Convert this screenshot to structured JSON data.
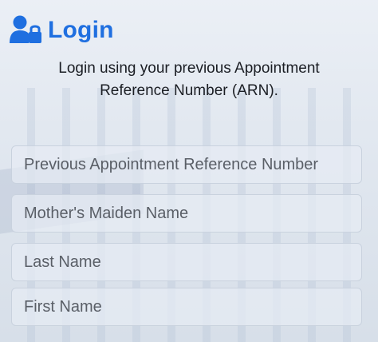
{
  "header": {
    "icon": "user-lock-icon",
    "title": "Login"
  },
  "description": {
    "line1": "Login using your previous Appointment",
    "line2": "Reference Number (ARN)."
  },
  "form": {
    "arn_placeholder": "Previous Appointment Reference Number",
    "maiden_placeholder": "Mother's Maiden Name",
    "last_name_placeholder": "Last Name",
    "first_name_placeholder": "First Name"
  },
  "colors": {
    "accent": "#1f6fe0",
    "text": "#1b1e24",
    "field_border": "#c9d2de"
  }
}
